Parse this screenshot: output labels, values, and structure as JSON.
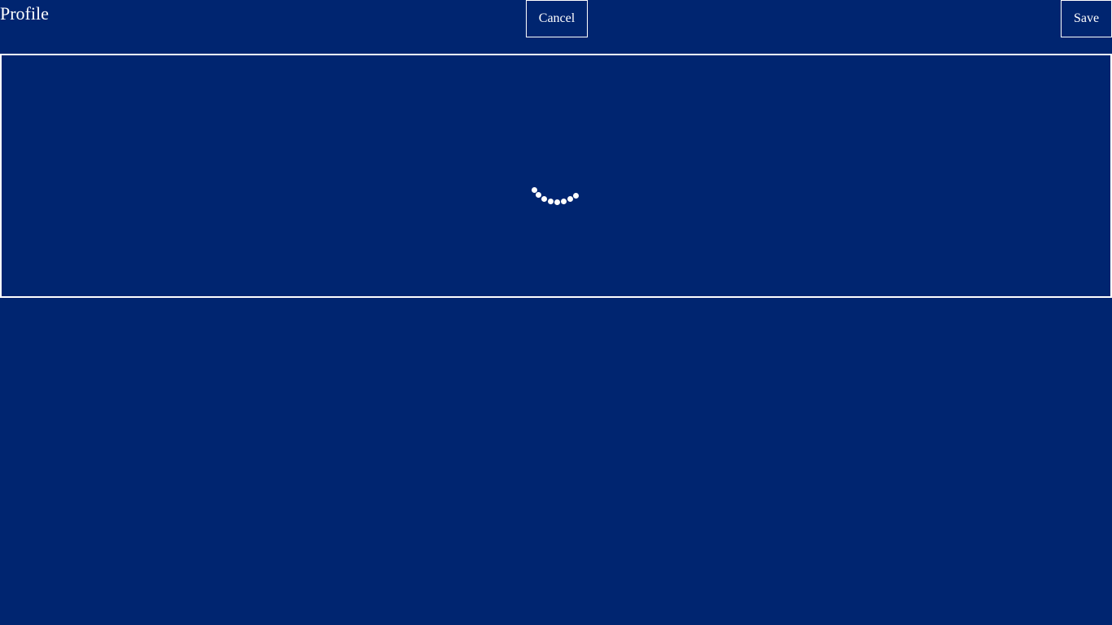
{
  "header": {
    "title": "Profile",
    "cancel_label": "Cancel",
    "save_label": "Save"
  },
  "content": {
    "loading_icon": "loading-spinner-icon"
  },
  "colors": {
    "background": "#002570",
    "foreground": "#ffffff"
  }
}
